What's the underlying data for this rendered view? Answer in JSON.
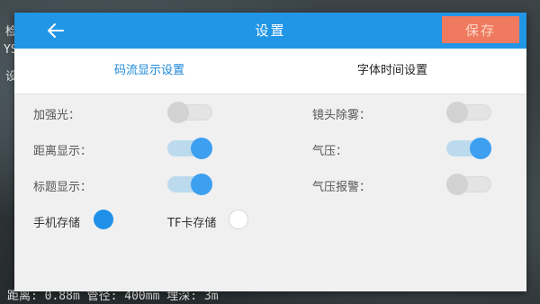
{
  "header": {
    "title": "设置",
    "save_label": "保存",
    "back_icon": "arrow-left-icon"
  },
  "tabs": [
    {
      "label": "码流显示设置",
      "active": true
    },
    {
      "label": "字体时间设置",
      "active": false
    }
  ],
  "settings": [
    {
      "label": "加强光：",
      "on": false
    },
    {
      "label": "镜头除雾：",
      "on": false
    },
    {
      "label": "距离显示：",
      "on": true
    },
    {
      "label": "气压：",
      "on": true
    },
    {
      "label": "标题显示：",
      "on": true
    },
    {
      "label": "气压报警：",
      "on": false
    }
  ],
  "storage": [
    {
      "label": "手机存储",
      "checked": true
    },
    {
      "label": "TF卡存储",
      "checked": false
    }
  ],
  "background": {
    "status_line": "距离: 0.88m  管径: 400mm  埋深: 3m",
    "left_chars": [
      "检",
      "YS",
      "设"
    ]
  },
  "colors": {
    "accent": "#2196e6",
    "save": "#ef7a5f",
    "switch_on": "#3d9ff0",
    "switch_off": "#d2d2d2"
  }
}
